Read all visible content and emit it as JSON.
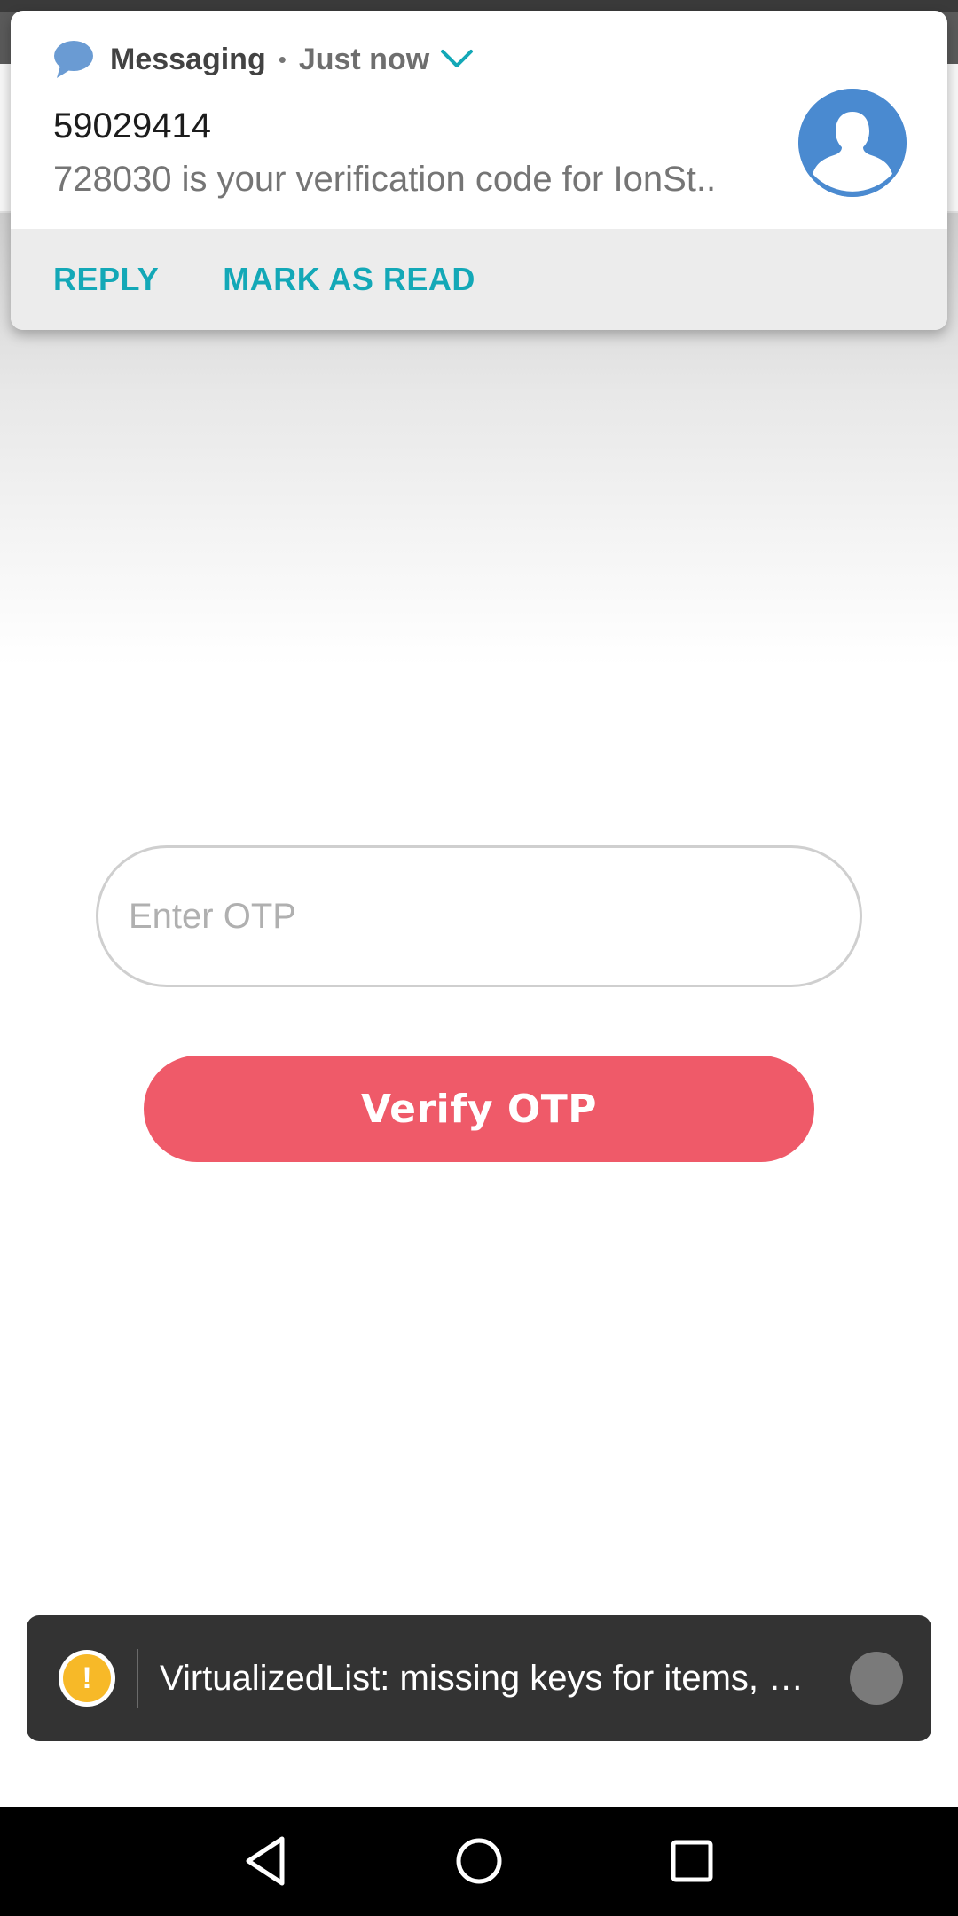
{
  "notification": {
    "app_name": "Messaging",
    "separator": "•",
    "time": "Just now",
    "sender": "59029414",
    "preview": "728030 is your verification code for IonSt..",
    "actions": {
      "reply": "REPLY",
      "mark_as_read": "MARK AS READ"
    },
    "icons": {
      "app": "chat-bubble-icon",
      "expand": "chevron-down-icon",
      "avatar": "person-avatar-icon"
    },
    "colors": {
      "accent": "#13a8b7",
      "avatar_bg": "#4a8ad0"
    }
  },
  "otp_form": {
    "placeholder": "Enter OTP",
    "value": "",
    "verify_label": "Verify OTP",
    "button_color": "#ef5a69"
  },
  "toast": {
    "message": "VirtualizedList: missing keys for items, …",
    "icon": "warning-icon",
    "warning_color": "#f7b928"
  },
  "navigation_bar": {
    "buttons": [
      "back",
      "home",
      "recents"
    ]
  }
}
